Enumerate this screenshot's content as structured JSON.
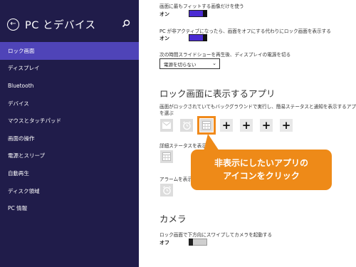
{
  "sidebar": {
    "title": "PC とデバイス",
    "items": [
      {
        "label": "ロック画面",
        "active": true
      },
      {
        "label": "ディスプレイ"
      },
      {
        "label": "Bluetooth"
      },
      {
        "label": "デバイス"
      },
      {
        "label": "マウスとタッチパッド"
      },
      {
        "label": "画面の操作"
      },
      {
        "label": "電源とスリープ"
      },
      {
        "label": "自動再生"
      },
      {
        "label": "ディスク領域"
      },
      {
        "label": "PC 情報"
      }
    ]
  },
  "main": {
    "fit_images": {
      "label": "画面に最もフィットする画像だけを使う",
      "state": "オン"
    },
    "inactive_slideshow": {
      "label": "PC が非アクティブになったら、画面をオフにする代わりにロック画面を表示する",
      "state": "オン"
    },
    "display_off": {
      "label": "次の時間スライドショーを再生後、ディスプレイの電源を切る",
      "value": "電源を切らない"
    },
    "lock_apps": {
      "title": "ロック画面に表示するアプリ",
      "desc_line1": "画面がロックされていてもバックグラウンドで実行し、簡易ステータスと通知を表示するアプリ",
      "desc_line2": "を選ぶ"
    },
    "detailed_status": {
      "label": "詳細ステータスを表示する"
    },
    "alarm": {
      "label": "アラームを表示"
    },
    "camera": {
      "title": "カメラ",
      "label": "ロック画面で下方向にスワイプしてカメラを起動する",
      "state": "オフ"
    }
  },
  "callout": {
    "line1": "非表示にしたいアプリの",
    "line2": "アイコンをクリック"
  },
  "colors": {
    "sidebar_bg": "#201c4a",
    "sidebar_active": "#4f44b8",
    "toggle_on": "#4a2bd2",
    "callout": "#ee8a18"
  }
}
